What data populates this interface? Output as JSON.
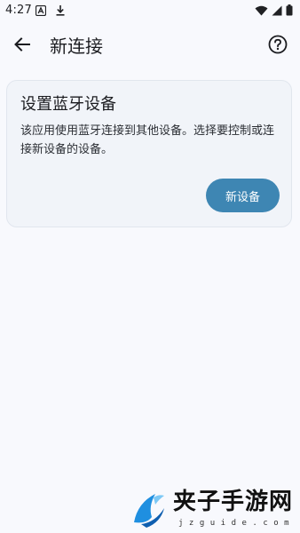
{
  "status_bar": {
    "time": "4:27",
    "left_icons": [
      "font-notification-icon",
      "download-icon"
    ],
    "right_icons": [
      "wifi-icon",
      "signal-icon",
      "battery-icon"
    ]
  },
  "app_bar": {
    "title": "新连接",
    "back_icon": "arrow-left-icon",
    "help_icon": "help-circle-icon"
  },
  "card": {
    "title": "设置蓝牙设备",
    "description": "该应用使用蓝牙连接到其他设备。选择要控制或连接新设备的设备。",
    "button_label": "新设备",
    "accent_color": "#3e86b3"
  },
  "watermark": {
    "text_cn": "夹子手游网",
    "text_en": "jzguide.com"
  }
}
